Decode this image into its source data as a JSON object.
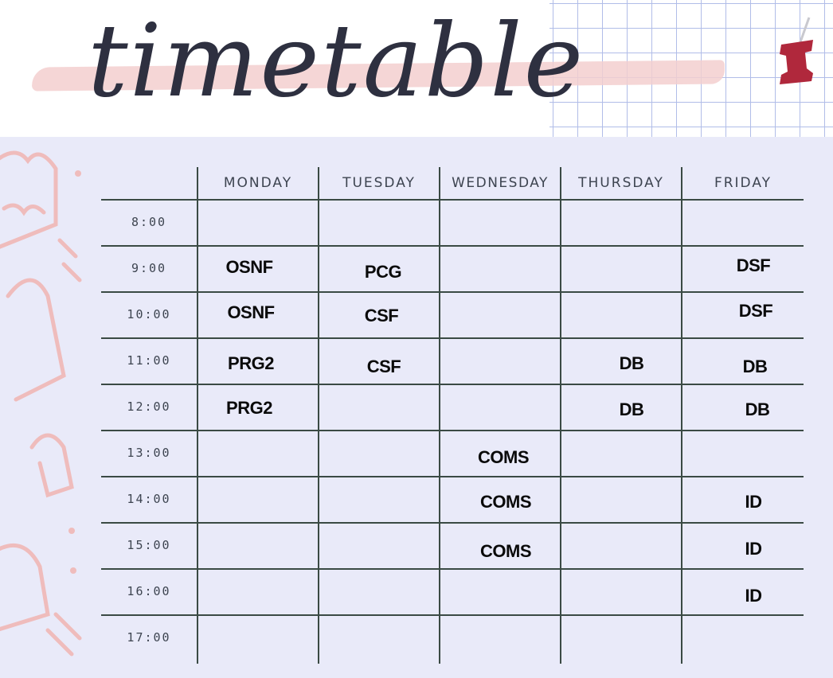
{
  "title": "timetable",
  "days": [
    "MONDAY",
    "TUESDAY",
    "WEDNESDAY",
    "THURSDAY",
    "FRIDAY"
  ],
  "times": [
    "8:00",
    "9:00",
    "10:00",
    "11:00",
    "12:00",
    "13:00",
    "14:00",
    "15:00",
    "16:00",
    "17:00"
  ],
  "schedule": {
    "monday": [
      "",
      "OSNF",
      "OSNF",
      "PRG2",
      "PRG2",
      "",
      "",
      "",
      "",
      ""
    ],
    "tuesday": [
      "",
      "PCG",
      "CSF",
      "CSF",
      "",
      "",
      "",
      "",
      "",
      ""
    ],
    "wednesday": [
      "",
      "",
      "",
      "",
      "",
      "COMS",
      "COMS",
      "COMS",
      "",
      ""
    ],
    "thursday": [
      "",
      "",
      "",
      "DB",
      "DB",
      "",
      "",
      "",
      "",
      ""
    ],
    "friday": [
      "",
      "DSF",
      "DSF",
      "DB",
      "DB",
      "",
      "ID",
      "ID",
      "ID",
      ""
    ]
  },
  "colors": {
    "ink": "#2e3040",
    "board": "#e9eaf9",
    "pink": "#f3cfcf",
    "grid": "#a9b6e6",
    "pin": "#b0283c",
    "lines": "#3a4a44"
  },
  "icons": [
    "push-pin-icon",
    "cactus-doodle",
    "potted-plant-doodle",
    "grid-paper"
  ]
}
